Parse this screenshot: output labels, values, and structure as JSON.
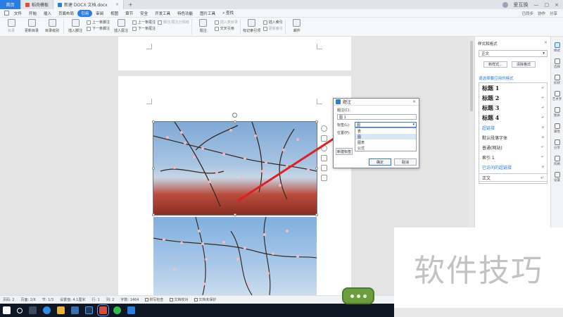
{
  "tabs": [
    {
      "label": "首页",
      "kind": "home"
    },
    {
      "label": "稻壳模板",
      "kind": "template"
    },
    {
      "label": "新建 DOCX 文档.docx",
      "kind": "document",
      "active": true
    }
  ],
  "window": {
    "user": "爱互换",
    "new_tab": "+"
  },
  "menu": {
    "file": "文件",
    "items": [
      "开始",
      "插入",
      "页面布局",
      "引用",
      "审阅",
      "视图",
      "章节",
      "安全",
      "开发工具",
      "特色功能",
      "图片工具"
    ],
    "active": "引用",
    "search": "查找",
    "right": [
      "已同步",
      "协作",
      "分享"
    ]
  },
  "ribbon": {
    "big": [
      {
        "label": "目录",
        "dim": true
      },
      {
        "label": "更新目录",
        "dim": false
      },
      {
        "label": "目录级别",
        "dim": false
      },
      {
        "label": "插入脚注",
        "dim": false
      }
    ],
    "col1": [
      "上一条脚注",
      "下一条脚注"
    ],
    "col2": [
      {
        "label": "插入尾注"
      }
    ],
    "col3": [
      "上一条尾注",
      "下一条尾注"
    ],
    "col4": [
      {
        "label": "脚注/尾注分隔线",
        "dim": true
      }
    ],
    "caption": "题注",
    "col5": [
      {
        "label": "插入表目录",
        "dim": true
      },
      {
        "label": "交叉引用",
        "dim": false
      }
    ],
    "mark": "标记索引项",
    "col6": [
      {
        "label": "插入索引",
        "dim": false
      },
      {
        "label": "更新索引",
        "dim": true
      }
    ],
    "mail": "邮件"
  },
  "dialog": {
    "title": "题注",
    "caption_label": "题注(C):",
    "caption_value": "图 1",
    "label_label": "标签(L):",
    "label_value": "图",
    "options": [
      "表",
      "图",
      "图表",
      "公式"
    ],
    "selected_option": "图",
    "position_label": "位置(P):",
    "new_label": "新建标签",
    "ok": "确定",
    "cancel": "取消",
    "close": "×"
  },
  "panel": {
    "title": "样式和格式",
    "current_style": "正文",
    "new_style": "新样式...",
    "clear_format": "清除格式",
    "apply_header": "请选择要应用的格式",
    "styles": [
      {
        "label": "标题 1",
        "kind": "h"
      },
      {
        "label": "标题 2",
        "kind": "h"
      },
      {
        "label": "标题 3",
        "kind": "h"
      },
      {
        "label": "标题 4",
        "kind": "h"
      },
      {
        "label": "超链接",
        "kind": "link"
      },
      {
        "label": "默认段落字体",
        "kind": "n"
      },
      {
        "label": "普通(网站)",
        "kind": "n"
      },
      {
        "label": "索引 1",
        "kind": "n"
      },
      {
        "label": "已访问的超链接",
        "kind": "link"
      }
    ],
    "bottom_style": "正文"
  },
  "side": [
    {
      "label": "样式",
      "active": true
    },
    {
      "label": "选择"
    },
    {
      "label": "形状"
    },
    {
      "label": "艺术字"
    },
    {
      "label": "图表"
    },
    {
      "label": "属性"
    },
    {
      "label": "分享"
    },
    {
      "label": "风格"
    },
    {
      "label": "设置"
    }
  ],
  "status": {
    "page_no": "页码: 2",
    "pages": "页面: 2/6",
    "section": "节: 1/3",
    "setting": "设置值: 4.1厘米",
    "row": "行: 1",
    "col": "列: 2",
    "words": "字数: 1464",
    "spell": "拼写检查",
    "doc_check": "文档校对",
    "protect": "文档未保护"
  },
  "watermark": "软件技巧",
  "colors": {
    "accent": "#2b7de1",
    "arrow": "#e02020"
  }
}
